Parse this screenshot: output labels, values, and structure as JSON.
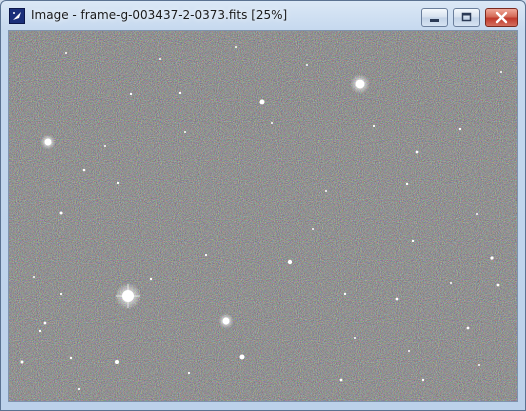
{
  "window": {
    "title": "Image - frame-g-003437-2-0373.fits [25%]",
    "controls": {
      "minimize_icon": "minimize-icon",
      "maximize_icon": "maximize-icon",
      "close_icon": "close-icon"
    },
    "app_icon": "astronomy-app-icon"
  },
  "image_view": {
    "content": "star-field",
    "background_color": "#3e3e3e"
  },
  "colors": {
    "titlebar": "#c5d8ee",
    "close_button": "#c0392b"
  }
}
